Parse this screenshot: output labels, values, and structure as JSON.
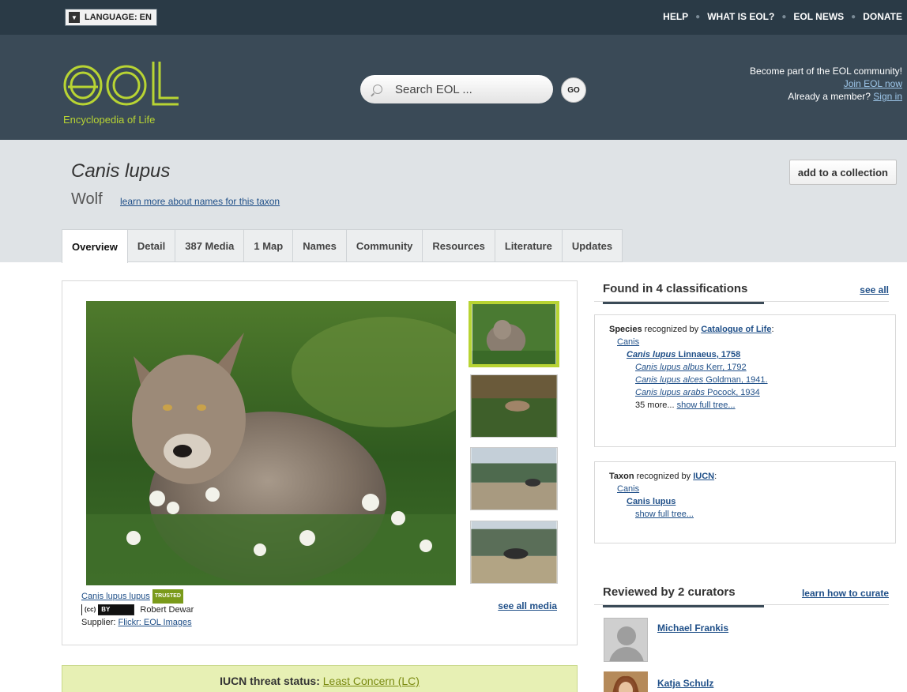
{
  "topbar": {
    "language_label": "LANGUAGE: EN",
    "links": [
      "HELP",
      "WHAT IS EOL?",
      "EOL NEWS",
      "DONATE"
    ]
  },
  "header": {
    "logo_text": "eOL",
    "tagline": "Encyclopedia of Life",
    "search_placeholder": "Search EOL ...",
    "go_label": "GO",
    "join_prompt": "Become part of the EOL community!",
    "join_link": "Join EOL now",
    "member_prompt": "Already a member?",
    "signin_link": "Sign in"
  },
  "taxon": {
    "scientific_name": "Canis lupus",
    "common_name": "Wolf",
    "names_link": "learn more about names for this taxon",
    "add_collection": "add to a collection"
  },
  "tabs": [
    {
      "label": "Overview",
      "active": true
    },
    {
      "label": "Detail",
      "active": false
    },
    {
      "label": "387 Media",
      "active": false
    },
    {
      "label": "1 Map",
      "active": false
    },
    {
      "label": "Names",
      "active": false
    },
    {
      "label": "Community",
      "active": false
    },
    {
      "label": "Resources",
      "active": false
    },
    {
      "label": "Literature",
      "active": false
    },
    {
      "label": "Updates",
      "active": false
    }
  ],
  "media": {
    "caption_taxon": "Canis lupus lupus",
    "trusted_badge": "TRUSTED",
    "license_cc": "(cc)",
    "license_by": "BY",
    "author": "Robert Dewar",
    "supplier_label": "Supplier:",
    "supplier_link": "Flickr: EOL Images",
    "see_all": "see all media"
  },
  "iucn": {
    "label": "IUCN threat status:",
    "status": "Least Concern (LC)"
  },
  "classifications": {
    "heading": "Found in 4 classifications",
    "see_all": "see all",
    "col": {
      "rank": "Species",
      "recognized_by": "recognized by",
      "source": "Catalogue of Life",
      "genus": "Canis",
      "species_italic": "Canis lupus",
      "species_author": "Linnaeus, 1758",
      "sub1_italic": "Canis lupus albus",
      "sub1_author": "Kerr, 1792",
      "sub2_italic": "Canis lupus alces",
      "sub2_author": "Goldman, 1941.",
      "sub3_italic": "Canis lupus arabs",
      "sub3_author": "Pocock, 1934",
      "more_text": "35 more...",
      "show_tree": "show full tree..."
    },
    "iucn_box": {
      "rank": "Taxon",
      "recognized_by": "recognized by",
      "source": "IUCN",
      "genus": "Canis",
      "species": "Canis lupus",
      "show_tree": "show full tree..."
    }
  },
  "curators": {
    "heading": "Reviewed by 2 curators",
    "learn_link": "learn how to curate",
    "people": [
      "Michael Frankis",
      "Katja Schulz"
    ]
  },
  "colors": {
    "topbar": "#2a3a46",
    "header": "#3a4a57",
    "logo_green": "#b8d433",
    "band": "#dfe3e6",
    "link": "#1f4f88",
    "iucn_bg": "#e7f0b4"
  }
}
